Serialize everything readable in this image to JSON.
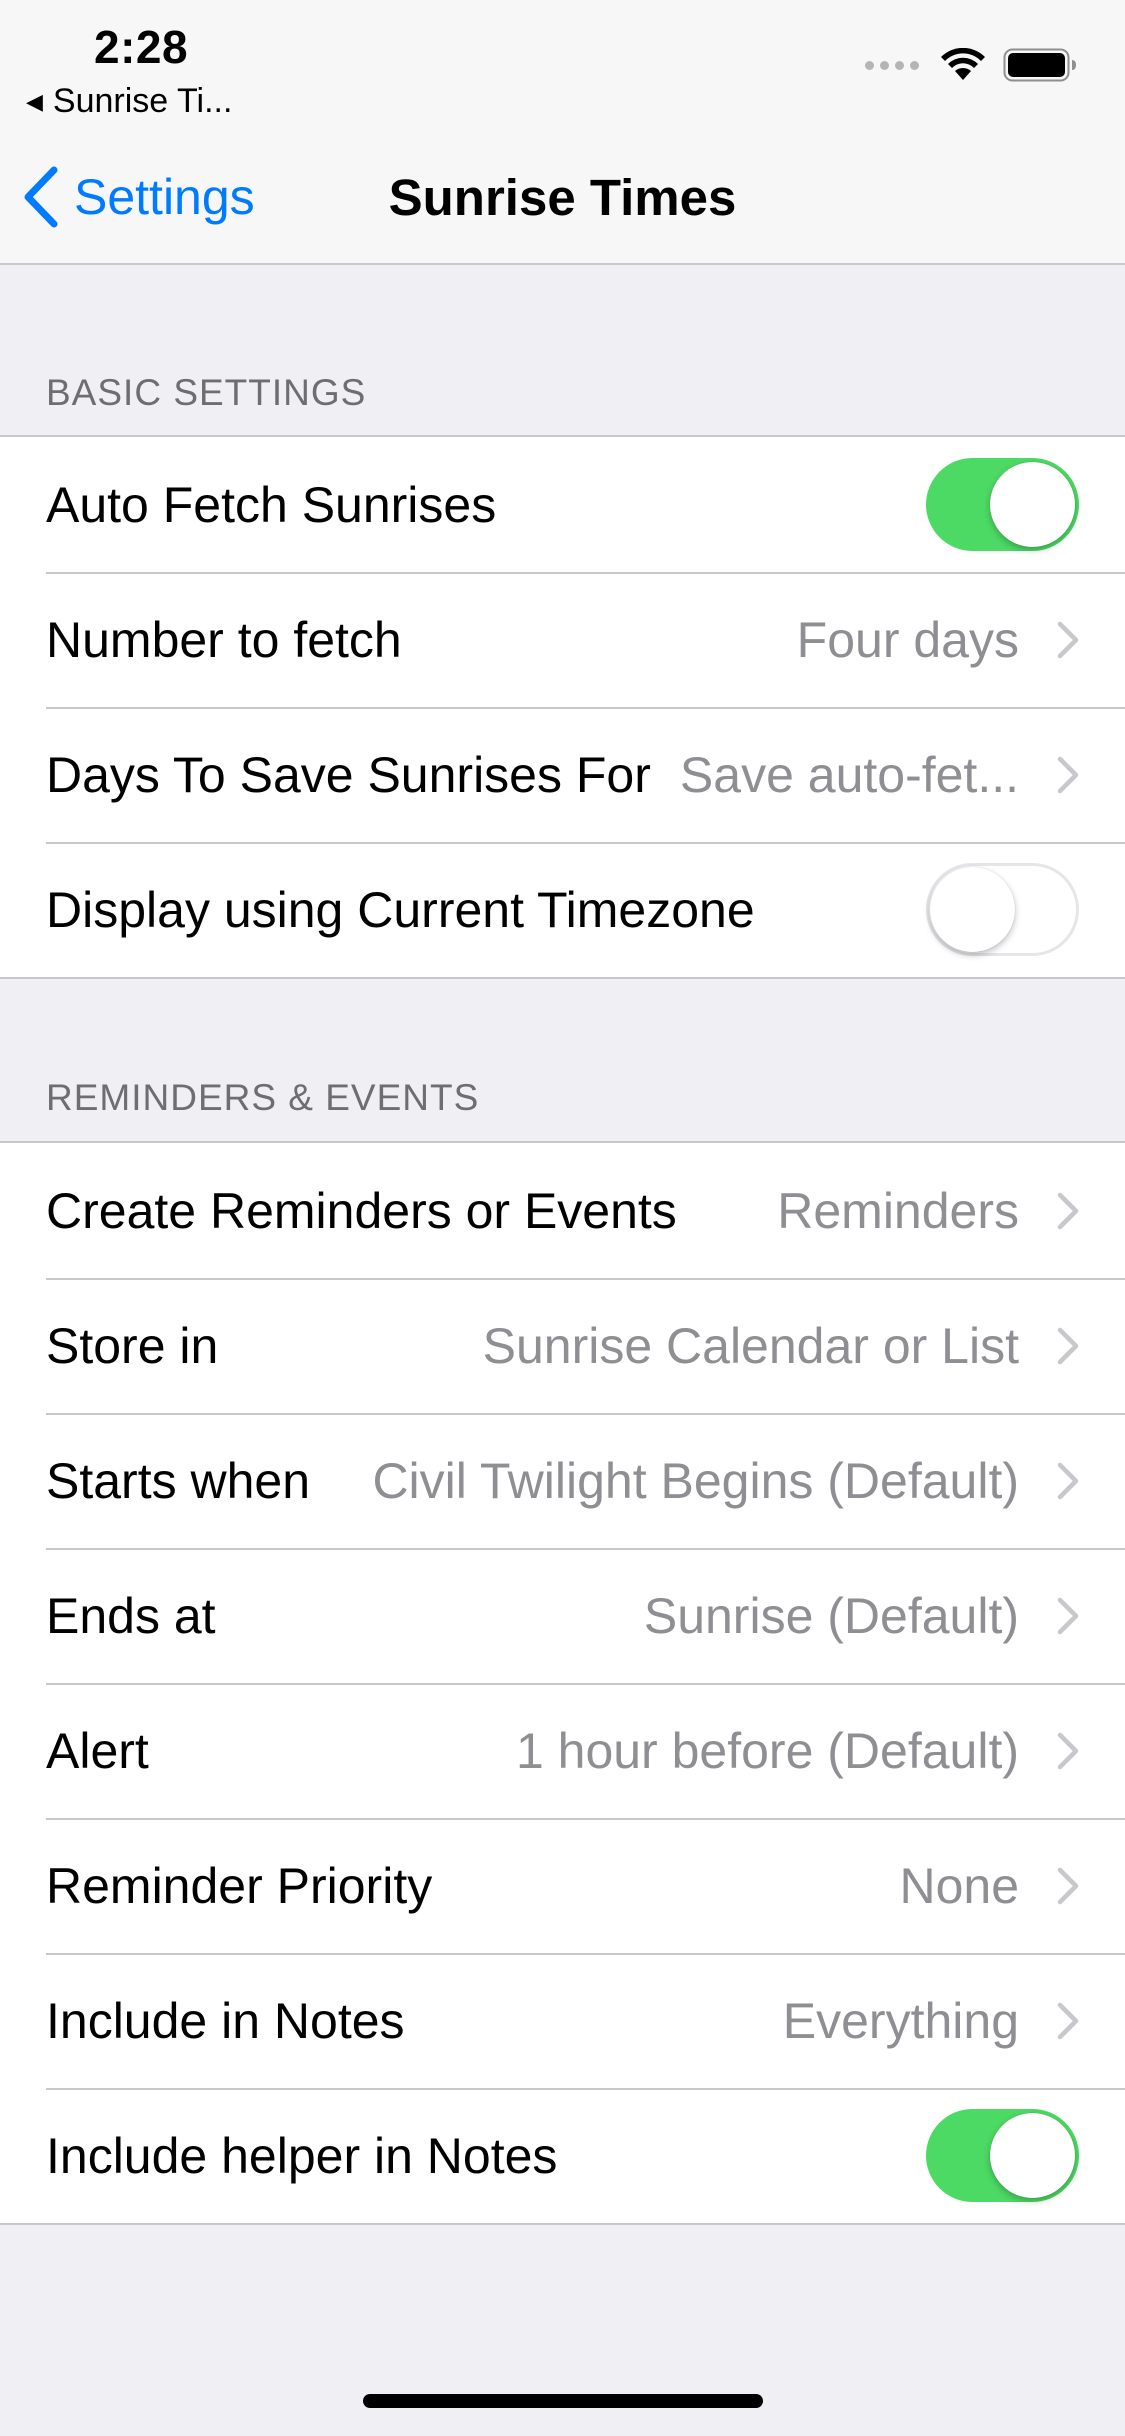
{
  "status_bar": {
    "time": "2:28",
    "back_app": "Sunrise Ti...",
    "icons": [
      "signal-dots-icon",
      "wifi-icon",
      "battery-icon"
    ]
  },
  "nav": {
    "back_label": "Settings",
    "title": "Sunrise Times"
  },
  "sections": {
    "basic": {
      "header": "BASIC SETTINGS",
      "rows": [
        {
          "label": "Auto Fetch Sunrises",
          "toggle": "on"
        },
        {
          "label": "Number to fetch",
          "value": "Four days"
        },
        {
          "label": "Days To Save Sunrises For",
          "value": "Save auto-fet..."
        },
        {
          "label": "Display using Current Timezone",
          "toggle": "off"
        }
      ]
    },
    "reminders": {
      "header": "REMINDERS & EVENTS",
      "rows": [
        {
          "label": "Create Reminders or Events",
          "value": "Reminders"
        },
        {
          "label": "Store in",
          "value": "Sunrise Calendar or List"
        },
        {
          "label": "Starts when",
          "value": "Civil Twilight Begins (Default)"
        },
        {
          "label": "Ends at",
          "value": "Sunrise (Default)"
        },
        {
          "label": "Alert",
          "value": "1 hour before (Default)"
        },
        {
          "label": "Reminder Priority",
          "value": "None"
        },
        {
          "label": "Include in Notes",
          "value": "Everything"
        },
        {
          "label": "Include helper in Notes",
          "toggle": "on"
        }
      ]
    }
  },
  "colors": {
    "accent": "#007aff",
    "toggle_on": "#4cd964",
    "background": "#efeff4",
    "secondary_text": "#8e8e93"
  }
}
